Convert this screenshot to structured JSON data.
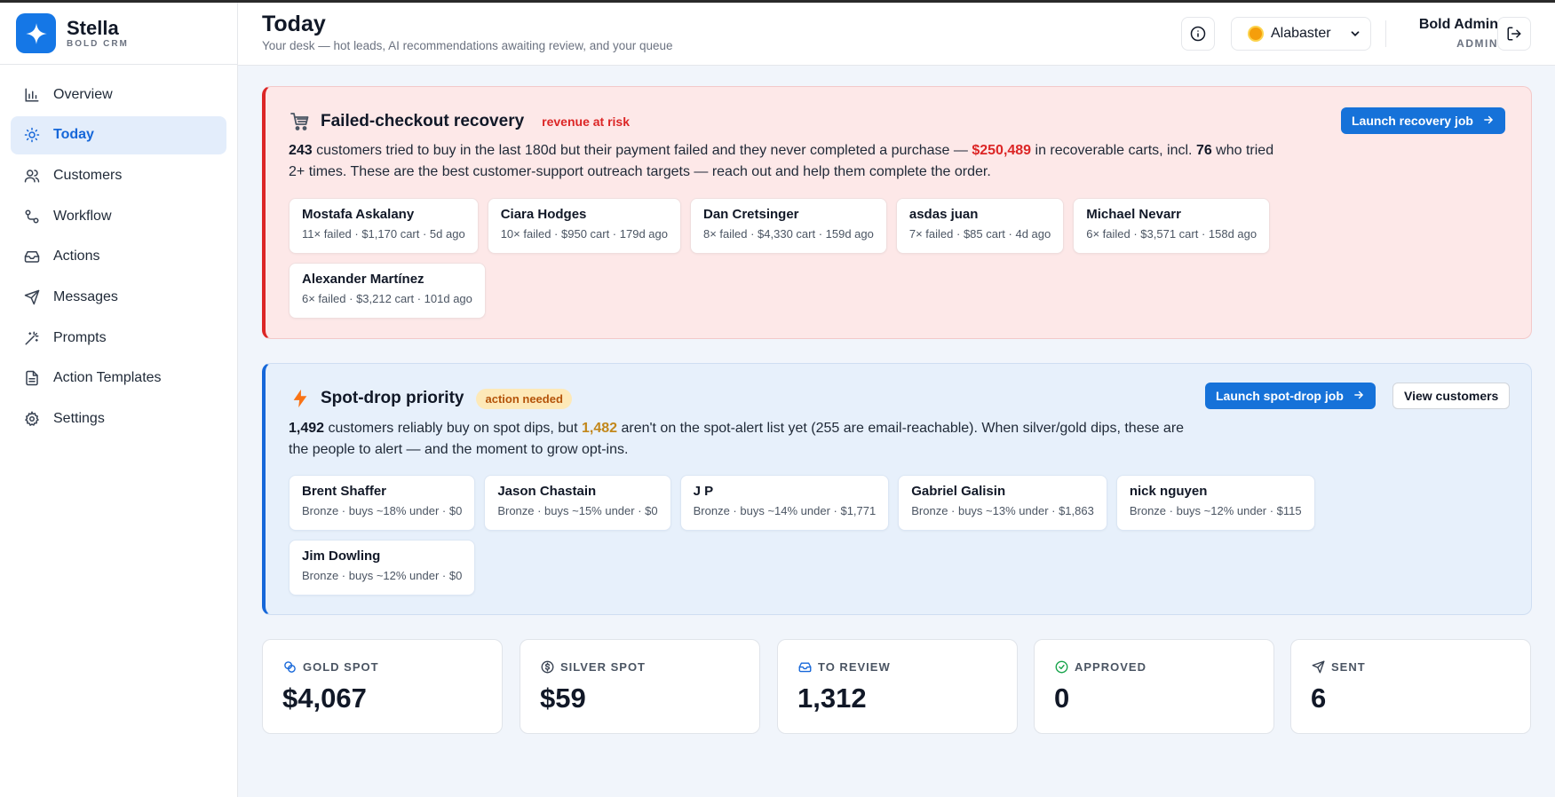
{
  "brand": {
    "name": "Stella",
    "sub": "BOLD CRM"
  },
  "nav": [
    {
      "label": "Overview",
      "icon": "bar-chart-icon"
    },
    {
      "label": "Today",
      "icon": "sun-icon",
      "active": true
    },
    {
      "label": "Customers",
      "icon": "users-icon"
    },
    {
      "label": "Workflow",
      "icon": "workflow-icon"
    },
    {
      "label": "Actions",
      "icon": "inbox-icon"
    },
    {
      "label": "Messages",
      "icon": "send-icon"
    },
    {
      "label": "Prompts",
      "icon": "magic-wand-icon"
    },
    {
      "label": "Action Templates",
      "icon": "document-icon"
    },
    {
      "label": "Settings",
      "icon": "gear-icon"
    }
  ],
  "header": {
    "title": "Today",
    "subtitle": "Your desk — hot leads, AI recommendations awaiting review, and your queue",
    "theme": "Alabaster",
    "user_name": "Bold Admin",
    "user_role": "ADMIN"
  },
  "recovery": {
    "title": "Failed-checkout recovery",
    "tag": "revenue at risk",
    "button": "Launch recovery job",
    "desc_count": "243",
    "desc_part1": " customers tried to buy in the last 180d but their payment failed and they never completed a purchase — ",
    "desc_amount": "$250,489",
    "desc_part2": " in recoverable carts, incl. ",
    "desc_repeat": "76",
    "desc_part3": " who tried 2+ times. These are the best customer-support outreach targets — reach out and help them complete the order.",
    "customers": [
      {
        "name": "Mostafa Askalany",
        "meta": "11× failed · $1,170 cart · 5d ago"
      },
      {
        "name": "Ciara Hodges",
        "meta": "10× failed · $950 cart · 179d ago"
      },
      {
        "name": "Dan Cretsinger",
        "meta": "8× failed · $4,330 cart · 159d ago"
      },
      {
        "name": "asdas juan",
        "meta": "7× failed · $85 cart · 4d ago"
      },
      {
        "name": "Michael Nevarr",
        "meta": "6× failed · $3,571 cart · 158d ago"
      },
      {
        "name": "Alexander Martínez",
        "meta": "6× failed · $3,212 cart · 101d ago"
      }
    ]
  },
  "spotdrop": {
    "title": "Spot-drop priority",
    "tag": "action needed",
    "button_primary": "Launch spot-drop job",
    "button_secondary": "View customers",
    "desc_count": "1,492",
    "desc_part1": " customers reliably buy on spot dips, but ",
    "desc_missing": "1,482",
    "desc_part2": " aren't on the spot-alert list yet (255 are email-reachable). When silver/gold dips, these are the people to alert — and the moment to grow opt-ins.",
    "customers": [
      {
        "name": "Brent Shaffer",
        "meta": "Bronze · buys ~18% under · $0"
      },
      {
        "name": "Jason Chastain",
        "meta": "Bronze · buys ~15% under · $0"
      },
      {
        "name": "J P",
        "meta": "Bronze · buys ~14% under · $1,771"
      },
      {
        "name": "Gabriel Galisin",
        "meta": "Bronze · buys ~13% under · $1,863"
      },
      {
        "name": "nick nguyen",
        "meta": "Bronze · buys ~12% under · $115"
      },
      {
        "name": "Jim Dowling",
        "meta": "Bronze · buys ~12% under · $0"
      }
    ]
  },
  "stats": [
    {
      "label": "GOLD SPOT",
      "value": "$4,067",
      "icon": "coins-icon"
    },
    {
      "label": "SILVER SPOT",
      "value": "$59",
      "icon": "dollar-circle-icon"
    },
    {
      "label": "TO REVIEW",
      "value": "1,312",
      "icon": "inbox-icon"
    },
    {
      "label": "APPROVED",
      "value": "0",
      "icon": "check-circle-icon"
    },
    {
      "label": "SENT",
      "value": "6",
      "icon": "send-icon"
    }
  ],
  "colors": {
    "accent": "#1672d9",
    "danger": "#dc2626",
    "warning": "#c2871b"
  }
}
